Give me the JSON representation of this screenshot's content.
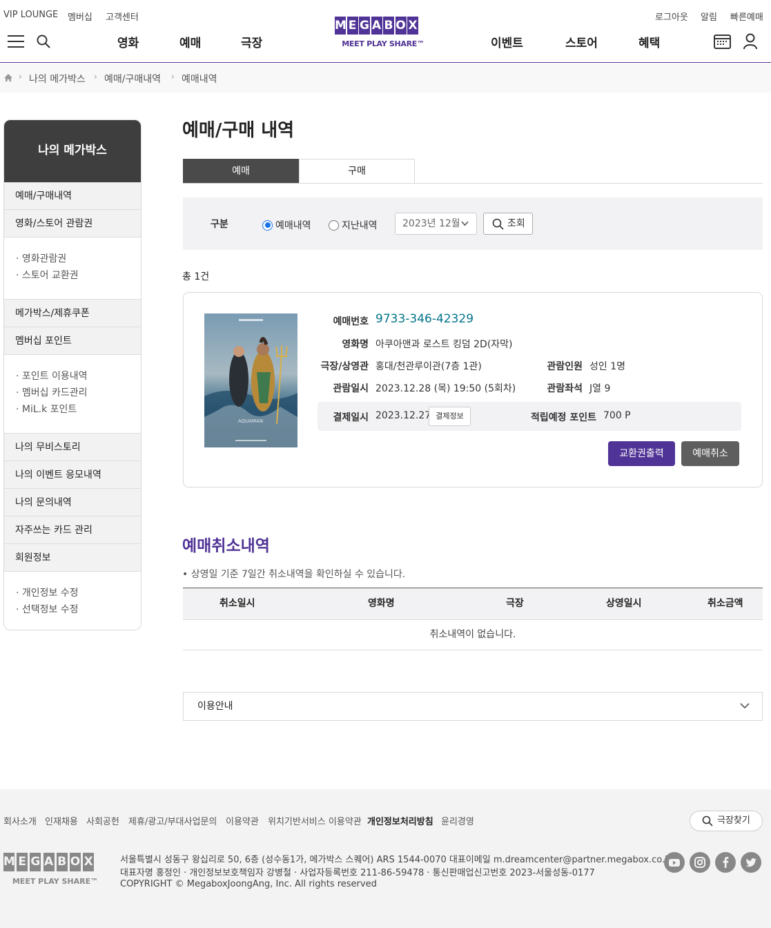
{
  "header": {
    "util_left": [
      "VIP LOUNGE",
      "멤버십",
      "고객센터"
    ],
    "util_right": [
      "로그아웃",
      "알림",
      "빠른예매"
    ],
    "nav_left": [
      "영화",
      "예매",
      "극장"
    ],
    "nav_right": [
      "이벤트",
      "스토어",
      "혜택"
    ],
    "logo_letters": [
      "M",
      "E",
      "G",
      "A",
      "B",
      "O",
      "X"
    ],
    "logo_tagline": "MEET PLAY SHARE™",
    "brand_color": "#503396"
  },
  "breadcrumb": [
    "나의 메가박스",
    "예매/구매내역",
    "예매내역"
  ],
  "sidebar": {
    "title": "나의 메가박스",
    "menu1": "예매/구매내역",
    "menu2": "영화/스토어 관람권",
    "menu2_sub": [
      "· 영화관람권",
      "· 스토어 교환권"
    ],
    "menu3": "메가박스/제휴쿠폰",
    "menu4": "멤버십 포인트",
    "menu4_sub": [
      "· 포인트 이용내역",
      "· 멤버십 카드관리",
      "· MiL.k 포인트"
    ],
    "menu5": "나의 무비스토리",
    "menu6": "나의 이벤트 응모내역",
    "menu7": "나의 문의내역",
    "menu8": "자주쓰는 카드 관리",
    "menu9": "회원정보",
    "menu9_sub": [
      "· 개인정보 수정",
      "· 선택정보 수정"
    ]
  },
  "main": {
    "title": "예매/구매 내역",
    "tabs": [
      "예매",
      "구매"
    ],
    "filter": {
      "label": "구분",
      "radio_current": "예매내역",
      "radio_past": "지난내역",
      "selected_month": "2023년 12월",
      "search_button": "조회"
    },
    "total": "총 1건",
    "booking": {
      "number_label": "예매번호",
      "number": "9733-346-42329",
      "movie_label": "영화명",
      "movie": "아쿠아맨과 로스트 킹덤 2D(자막)",
      "theater_label": "극장/상영관",
      "theater": "홍대/천관루이관(7층 1관)",
      "people_label": "관람인원",
      "people": "성인 1명",
      "date_label": "관람일시",
      "date": "2023.12.28 (목) 19:50 (5회차)",
      "seat_label": "관람좌석",
      "seat": "J열 9",
      "pay_label": "결제일시",
      "pay_date": "2023.12.27",
      "pay_info_button": "결제정보",
      "point_label": "적립예정 포인트",
      "point": "700 P",
      "print_button": "교환권출력",
      "cancel_button": "예매취소",
      "poster_title_text": "AQUAMAN"
    },
    "cancel_section": {
      "title": "예매취소내역",
      "note": "• 상영일 기준 7일간 취소내역을 확인하실 수 있습니다.",
      "columns": [
        "취소일시",
        "영화명",
        "극장",
        "상영일시",
        "취소금액"
      ],
      "empty": "취소내역이 없습니다."
    },
    "guide": "이용안내"
  },
  "footer": {
    "links": [
      "회사소개",
      "인재채용",
      "사회공헌",
      "제휴/광고/부대사업문의",
      "이용약관",
      "위치기반서비스 이용약관",
      "개인정보처리방침",
      "윤리경영"
    ],
    "find_theater": "극장찾기",
    "address1": "서울특별시 성동구 왕십리로 50, 6층 (성수동1가, 메가박스 스퀘어) ARS 1544-0070 대표이메일 m.dreamcenter@partner.megabox.co.kr",
    "address2": "대표자명 홍정인 · 개인정보보호책임자 강병철 · 사업자등록번호 211-86-59478 · 통신판매업신고번호 2023-서울성동-0177",
    "copyright": "COPYRIGHT © MegaboxJoongAng, Inc. All rights reserved",
    "sns": [
      "youtube-icon",
      "instagram-icon",
      "facebook-icon",
      "twitter-icon"
    ]
  }
}
